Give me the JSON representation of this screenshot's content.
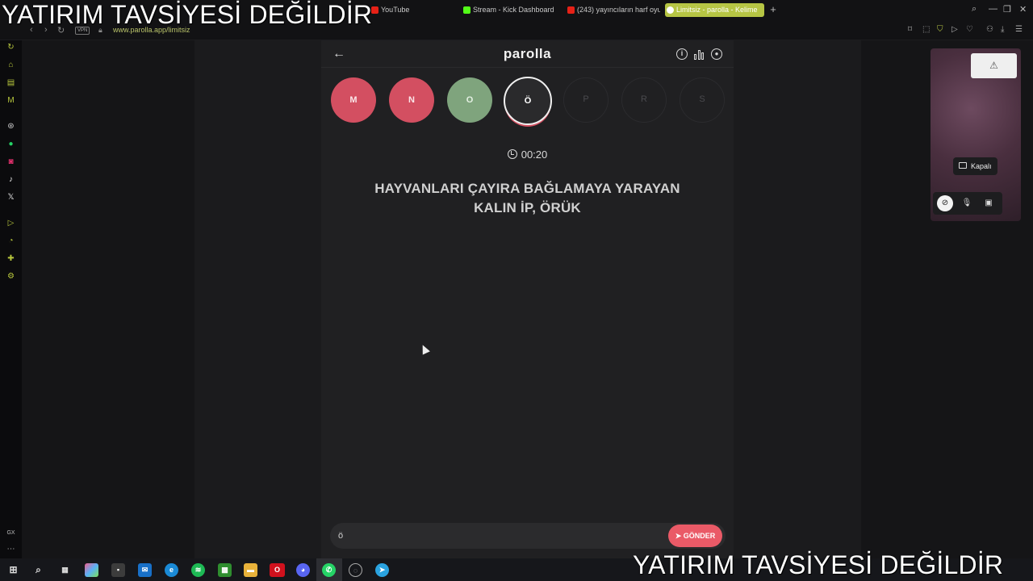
{
  "browser": {
    "tabs": [
      {
        "label": "YouTube",
        "color": "#e62117"
      },
      {
        "label": "Stream - Kick Dashboard",
        "color": "#53fc18"
      },
      {
        "label": "(243) yayıncıların harf oyu",
        "color": "#e62117"
      },
      {
        "label": "Limitsiz - parolla - Kelime",
        "color": "#ffffff"
      }
    ],
    "url": "www.parolla.app/limitsiz",
    "vpn_label": "VPN"
  },
  "app": {
    "logo": "parolla",
    "letters": [
      {
        "letter": "M",
        "state": "wrong"
      },
      {
        "letter": "N",
        "state": "wrong"
      },
      {
        "letter": "O",
        "state": "correct"
      },
      {
        "letter": "Ö",
        "state": "current"
      },
      {
        "letter": "P",
        "state": "pending"
      },
      {
        "letter": "R",
        "state": "pending"
      },
      {
        "letter": "S",
        "state": "pending"
      }
    ],
    "timer": "00:20",
    "clue": "HAYVANLARI ÇAYIRA BAĞLAMAYA YARAYAN KALIN İP, ÖRÜK",
    "answer_value": "ö",
    "send_label": "GÖNDER"
  },
  "webcam": {
    "status_label": "Kapalı"
  },
  "watermark": {
    "text": "YATIRIM TAVSİYESİ DEĞİLDİR"
  },
  "colors": {
    "wrong": "#d34f61",
    "correct": "#7fa47d",
    "accent": "#ea5a67",
    "browser_accent": "#b6c544"
  }
}
